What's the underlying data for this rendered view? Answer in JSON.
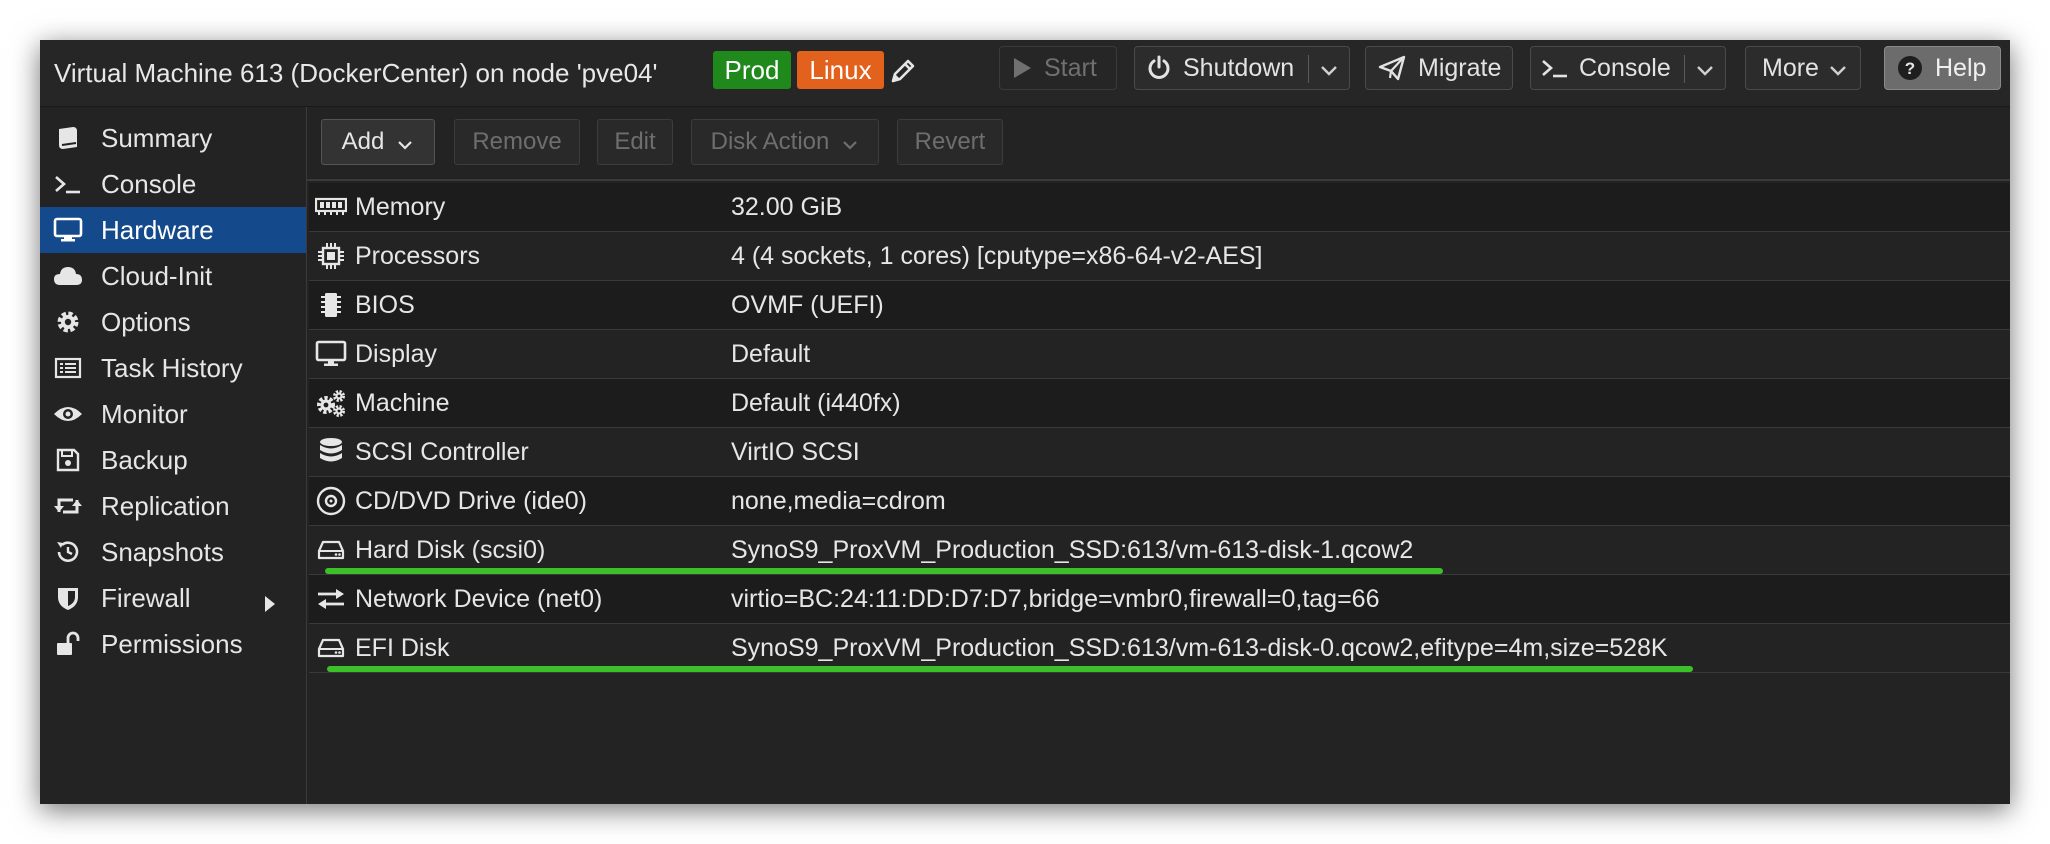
{
  "colors": {
    "prod_tag": "#1f8a1b",
    "linux_tag": "#e2611d",
    "active_nav": "#144a8b",
    "highlight_underline": "#3bc02a"
  },
  "header": {
    "title": "Virtual Machine 613 (DockerCenter) on node 'pve04'",
    "tags": {
      "prod": "Prod",
      "linux": "Linux"
    },
    "edit_tags_icon": "pencil-icon",
    "buttons": {
      "start": "Start",
      "shutdown": "Shutdown",
      "migrate": "Migrate",
      "console": "Console",
      "more": "More",
      "help": "Help"
    }
  },
  "sidebar": {
    "items": [
      {
        "label": "Summary",
        "icon": "book-icon"
      },
      {
        "label": "Console",
        "icon": "terminal-icon"
      },
      {
        "label": "Hardware",
        "icon": "monitor-icon",
        "active": true
      },
      {
        "label": "Cloud-Init",
        "icon": "cloud-icon"
      },
      {
        "label": "Options",
        "icon": "gear-icon"
      },
      {
        "label": "Task History",
        "icon": "list-icon"
      },
      {
        "label": "Monitor",
        "icon": "eye-icon"
      },
      {
        "label": "Backup",
        "icon": "floppy-icon"
      },
      {
        "label": "Replication",
        "icon": "retweet-icon"
      },
      {
        "label": "Snapshots",
        "icon": "history-icon"
      },
      {
        "label": "Firewall",
        "icon": "shield-icon"
      },
      {
        "label": "Permissions",
        "icon": "unlock-icon"
      }
    ]
  },
  "toolbar": {
    "add": "Add",
    "remove": "Remove",
    "edit": "Edit",
    "disk_action": "Disk Action",
    "revert": "Revert"
  },
  "hardware": {
    "rows": [
      {
        "name": "Memory",
        "value": "32.00 GiB",
        "icon": "memory-icon"
      },
      {
        "name": "Processors",
        "value": "4 (4 sockets, 1 cores) [cputype=x86-64-v2-AES]",
        "icon": "cpu-icon"
      },
      {
        "name": "BIOS",
        "value": "OVMF (UEFI)",
        "icon": "microchip-icon"
      },
      {
        "name": "Display",
        "value": "Default",
        "icon": "desktop-icon"
      },
      {
        "name": "Machine",
        "value": "Default (i440fx)",
        "icon": "cogs-icon"
      },
      {
        "name": "SCSI Controller",
        "value": "VirtIO SCSI",
        "icon": "database-icon"
      },
      {
        "name": "CD/DVD Drive (ide0)",
        "value": "none,media=cdrom",
        "icon": "cdrom-icon"
      },
      {
        "name": "Hard Disk (scsi0)",
        "value": "SynoS9_ProxVM_Production_SSD:613/vm-613-disk-1.qcow2",
        "icon": "hdd-icon"
      },
      {
        "name": "Network Device (net0)",
        "value": "virtio=BC:24:11:DD:D7:D7,bridge=vmbr0,firewall=0,tag=66",
        "icon": "exchange-icon"
      },
      {
        "name": "EFI Disk",
        "value": "SynoS9_ProxVM_Production_SSD:613/vm-613-disk-0.qcow2,efitype=4m,size=528K",
        "icon": "hdd-icon"
      }
    ]
  }
}
